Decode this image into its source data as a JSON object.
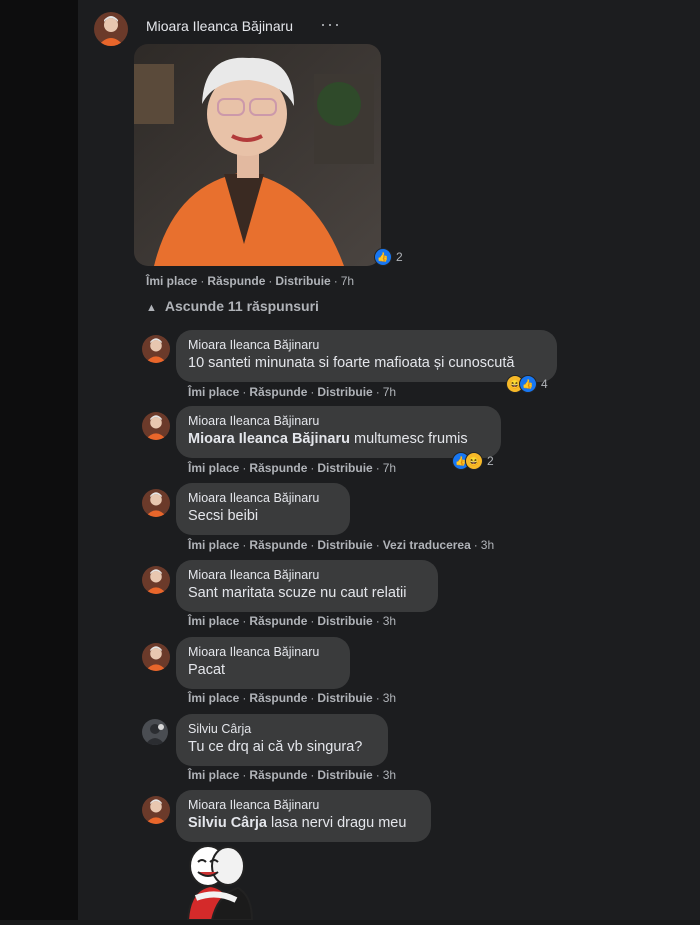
{
  "post": {
    "author": "Mioara Ileanca Băjinaru",
    "more": "···",
    "reaction_count": "2",
    "actions": {
      "like": "Îmi place",
      "reply": "Răspunde",
      "share": "Distribuie",
      "time": "7h"
    },
    "icons": {
      "avatar": "user-avatar-icon",
      "more": "more-dots-icon"
    }
  },
  "replies_toggle": "Ascunde 11 răspunsuri",
  "comments": [
    {
      "author": "Mioara Ileanca Băjinaru",
      "text": "10 santeti minunata si foarte mafioata și cunoscută",
      "reaction_count": "4",
      "actions": {
        "like": "Îmi place",
        "reply": "Răspunde",
        "share": "Distribuie",
        "time": "7h"
      }
    },
    {
      "author": "Mioara Ileanca Băjinaru",
      "mention": "Mioara Ileanca Băjinaru",
      "text": " multumesc frumis",
      "reaction_count": "2",
      "actions": {
        "like": "Îmi place",
        "reply": "Răspunde",
        "share": "Distribuie",
        "time": "7h"
      }
    },
    {
      "author": "Mioara Ileanca Băjinaru",
      "text": "Secsi beibi",
      "actions": {
        "like": "Îmi place",
        "reply": "Răspunde",
        "share": "Distribuie",
        "translate": "Vezi traducerea",
        "time": "3h"
      }
    },
    {
      "author": "Mioara Ileanca Băjinaru",
      "text": "Sant maritata scuze nu caut relatii",
      "actions": {
        "like": "Îmi place",
        "reply": "Răspunde",
        "share": "Distribuie",
        "time": "3h"
      }
    },
    {
      "author": "Mioara Ileanca Băjinaru",
      "text": "Pacat",
      "actions": {
        "like": "Îmi place",
        "reply": "Răspunde",
        "share": "Distribuie",
        "time": "3h"
      }
    },
    {
      "author": "Silviu Cârja",
      "text": "Tu ce drq ai că vb singura?",
      "actions": {
        "like": "Îmi place",
        "reply": "Răspunde",
        "share": "Distribuie",
        "time": "3h"
      }
    },
    {
      "author": "Mioara Ileanca Băjinaru",
      "mention": "Silviu Cârja",
      "text": " lasa nervi dragu meu"
    }
  ],
  "colors": {
    "background": "#1c1d1f",
    "bubble": "#3a3b3c",
    "like": "#1877f2",
    "haha": "#f7b928"
  }
}
